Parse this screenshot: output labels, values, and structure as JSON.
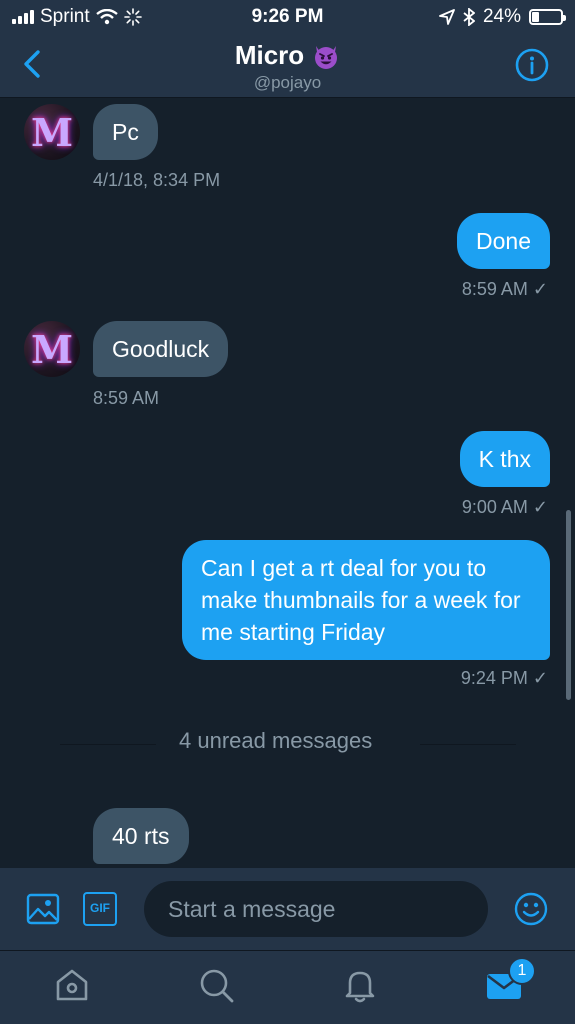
{
  "status_bar": {
    "carrier": "Sprint",
    "time": "9:26 PM",
    "battery": "24%",
    "icons": [
      "signal-icon",
      "wifi-icon",
      "activity-spinner-icon",
      "location-icon",
      "bluetooth-icon",
      "battery-icon"
    ]
  },
  "header": {
    "name": "Micro",
    "handle": "@pojayo",
    "emoji": "smiling-devil-emoji"
  },
  "messages": [
    {
      "side": "in",
      "text": "Pc",
      "time": "4/1/18, 8:34 PM"
    },
    {
      "side": "out",
      "text": "Done",
      "time": "8:59 AM ✓"
    },
    {
      "side": "in",
      "text": "Goodluck",
      "time": "8:59 AM"
    },
    {
      "side": "out",
      "text": "K thx",
      "time": "9:00 AM ✓"
    },
    {
      "side": "out",
      "text": "Can I get a rt deal for you to make thumbnails for a week for me starting Friday",
      "time": "9:24 PM ✓"
    },
    {
      "side": "in",
      "text": "40 rts",
      "time": ""
    }
  ],
  "unread_divider": "4 unread messages",
  "avatar_letter": "M",
  "composer": {
    "placeholder": "Start a message",
    "gif_label": "GIF"
  },
  "tabbar": {
    "messages_badge": "1"
  },
  "colors": {
    "background": "#15202b",
    "bar": "#243447",
    "accent": "#1da1f2",
    "incoming_bubble": "#3d5466",
    "muted_text": "#8899a6"
  }
}
